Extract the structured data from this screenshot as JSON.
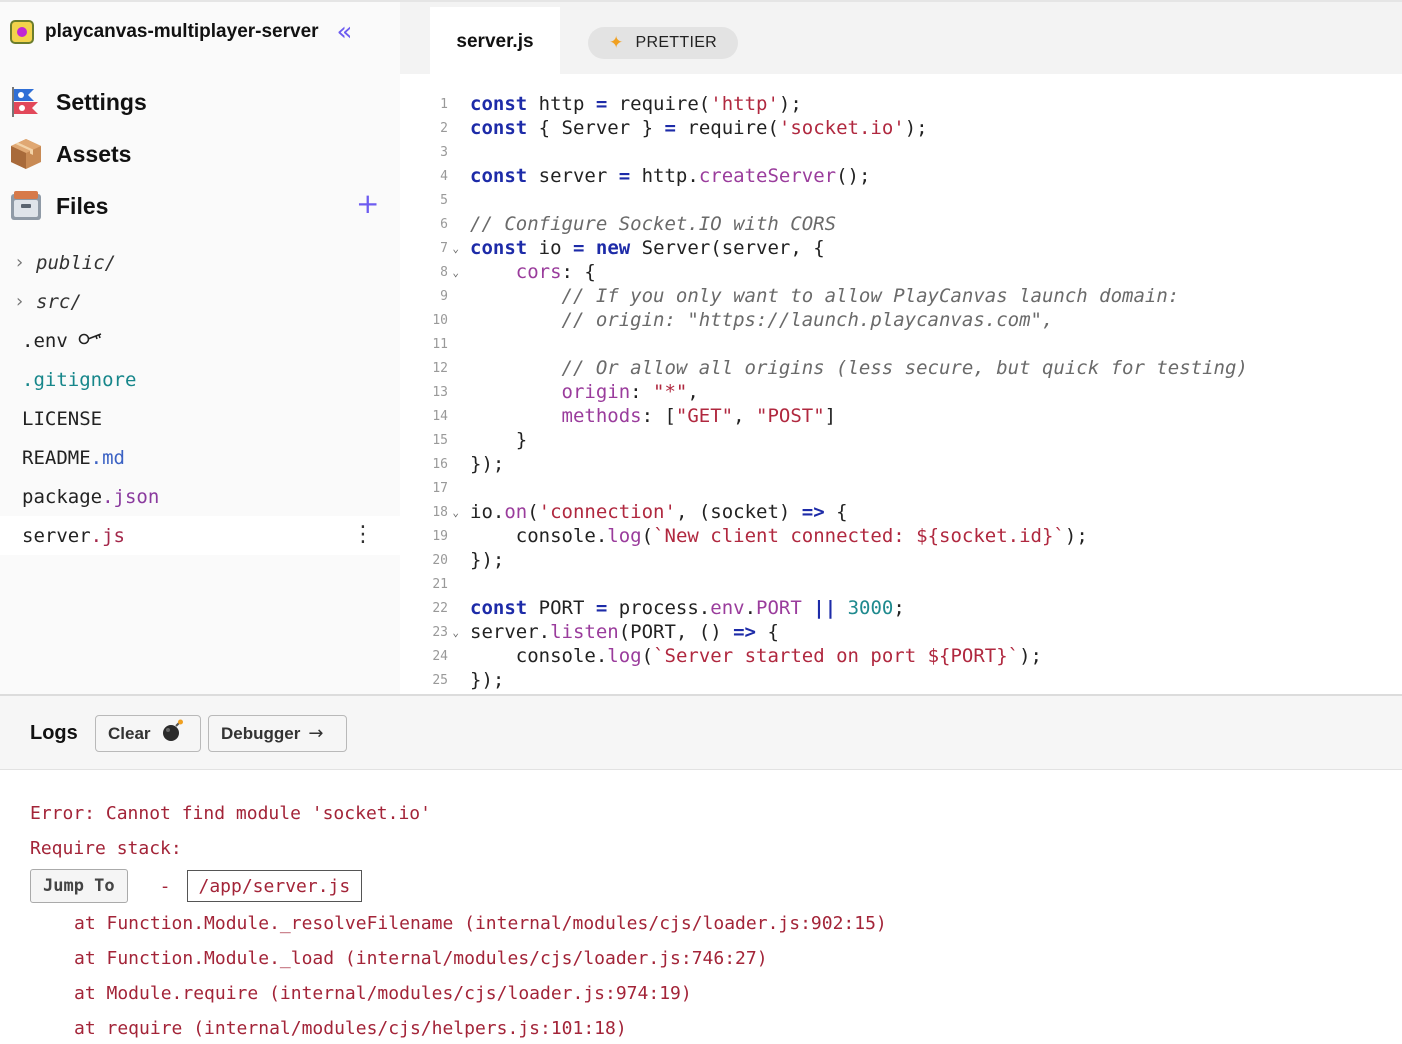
{
  "sidebar": {
    "project_name": "playcanvas-multiplayer-server",
    "nav": [
      {
        "label": "Settings",
        "icon": "flags-icon"
      },
      {
        "label": "Assets",
        "icon": "package-icon"
      },
      {
        "label": "Files",
        "icon": "file-cabinet-icon"
      }
    ],
    "files": [
      {
        "name": "public/",
        "type": "folder"
      },
      {
        "name": "src/",
        "type": "folder"
      },
      {
        "base": ".env",
        "ext": "",
        "icon": "key-icon"
      },
      {
        "base": "",
        "ext": ".gitignore"
      },
      {
        "base": "LICENSE",
        "ext": ""
      },
      {
        "base": "README",
        "ext": ".md"
      },
      {
        "base": "package",
        "ext": ".json"
      },
      {
        "base": "server",
        "ext": ".js",
        "active": true
      }
    ]
  },
  "editor": {
    "tab_label": "server.js",
    "prettier_label": "PRETTIER"
  },
  "code_lines": [
    "const http = require('http');",
    "const { Server } = require('socket.io');",
    "",
    "const server = http.createServer();",
    "",
    "// Configure Socket.IO with CORS",
    "const io = new Server(server, {",
    "    cors: {",
    "        // If you only want to allow PlayCanvas launch domain:",
    "        // origin: \"https://launch.playcanvas.com\",",
    "",
    "        // Or allow all origins (less secure, but quick for testing)",
    "        origin: \"*\",",
    "        methods: [\"GET\", \"POST\"]",
    "    }",
    "});",
    "",
    "io.on('connection', (socket) => {",
    "    console.log(`New client connected: ${socket.id}`);",
    "});",
    "",
    "const PORT = process.env.PORT || 3000;",
    "server.listen(PORT, () => {",
    "    console.log(`Server started on port ${PORT}`);",
    "});"
  ],
  "logs": {
    "title": "Logs",
    "clear_label": "Clear",
    "debugger_label": "Debugger",
    "error_line": "Error: Cannot find module 'socket.io'",
    "require_stack": "Require stack:",
    "jump_label": "Jump To",
    "jump_dash": "-",
    "jump_path": "/app/server.js",
    "stack": [
      "at Function.Module._resolveFilename (internal/modules/cjs/loader.js:902:15)",
      "at Function.Module._load (internal/modules/cjs/loader.js:746:27)",
      "at Module.require (internal/modules/cjs/loader.js:974:19)",
      "at require (internal/modules/cjs/helpers.js:101:18)"
    ]
  },
  "colors": {
    "accent": "#6d5cf0",
    "keyword": "#1d2ba8",
    "string": "#b0283f",
    "error": "#a32438"
  }
}
